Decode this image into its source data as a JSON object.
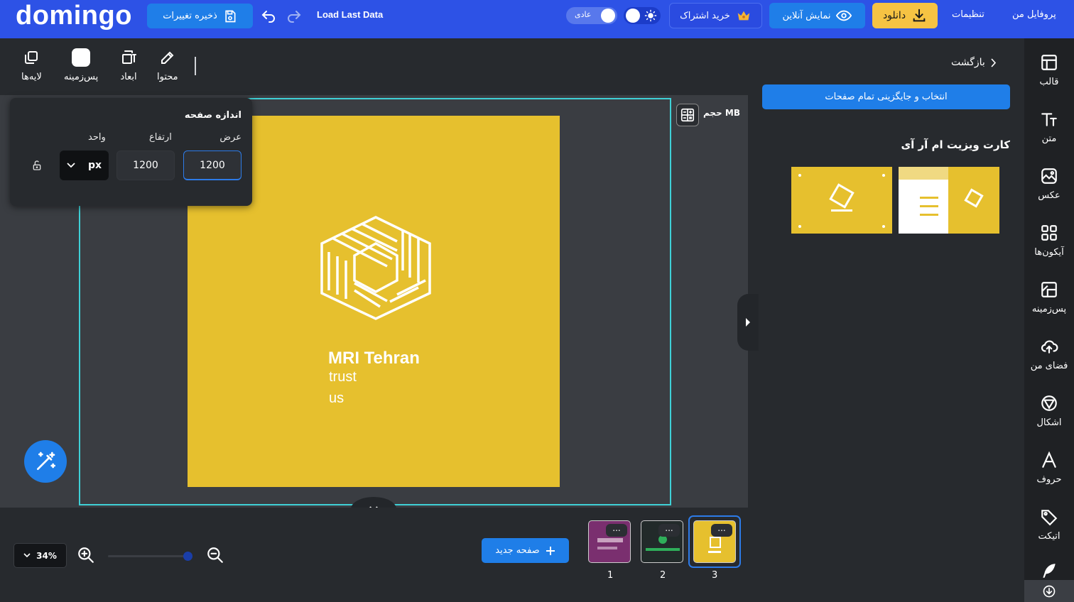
{
  "app": {
    "logo": "domingo",
    "save_label": "ذخیره تغییرات",
    "load_last_label": "Load Last Data",
    "mode_label": "عادی",
    "subscribe_label": "خرید اشتراک",
    "preview_label": "نمایش آنلاین",
    "download_label": "دانلود",
    "settings_label": "تنظیمات",
    "profile_label": "پروفایل من"
  },
  "toolbar": {
    "content_label": "محتوا",
    "dimensions_label": "ابعاد",
    "background_label": "پس‌زمینه",
    "layers_label": "لایه‌ها"
  },
  "page_size": {
    "title": "اندازه صفحه",
    "width_label": "عرض",
    "height_label": "ارتفاع",
    "unit_label": "واحد",
    "width_value": "1200",
    "height_value": "1200",
    "unit_value": "px"
  },
  "canvas": {
    "size_label": "حجم MB",
    "card_title": "MRI Tehran",
    "card_line1": "trust",
    "card_line2": "us",
    "card_color": "#e6c02e"
  },
  "bottom": {
    "zoom_value": "34%",
    "new_page_label": "صفحه جدید",
    "more_label": "...",
    "pages": [
      "1",
      "2",
      "3"
    ],
    "selected_page": "3"
  },
  "template_panel": {
    "back_label": "بازگشت",
    "replace_all_label": "انتخاب و جایگزینی تمام صفحات",
    "section_title": "کارت ویزیت ام آر آی"
  },
  "sidebar": {
    "items": [
      {
        "label": "قالب",
        "icon": "template-icon"
      },
      {
        "label": "متن",
        "icon": "text-icon"
      },
      {
        "label": "عکس",
        "icon": "image-icon"
      },
      {
        "label": "آیکون‌ها",
        "icon": "icons-grid-icon"
      },
      {
        "label": "پس‌زمینه",
        "icon": "background-icon"
      },
      {
        "label": "فضای من",
        "icon": "cloud-upload-icon"
      },
      {
        "label": "اشکال",
        "icon": "shapes-icon"
      },
      {
        "label": "حروف",
        "icon": "letters-icon"
      },
      {
        "label": "اتیکت",
        "icon": "sticker-icon"
      }
    ]
  },
  "colors": {
    "brand_blue": "#2d52e6",
    "button_blue": "#1f7ee8",
    "download_yellow": "#f6c343",
    "frame_cyan": "#3fd0d6"
  }
}
